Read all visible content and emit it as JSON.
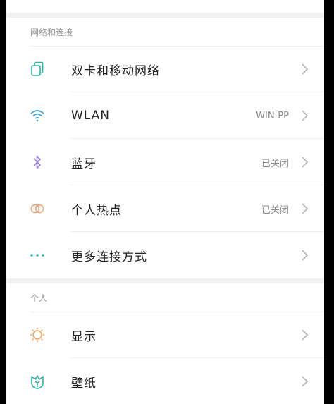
{
  "sections": [
    {
      "header": "网络和连接",
      "items": [
        {
          "label": "双卡和移动网络",
          "value": "",
          "icon": "dual-sim-icon"
        },
        {
          "label": "WLAN",
          "value": "WIN-PP",
          "icon": "wifi-icon"
        },
        {
          "label": "蓝牙",
          "value": "已关闭",
          "icon": "bluetooth-icon"
        },
        {
          "label": "个人热点",
          "value": "已关闭",
          "icon": "hotspot-icon"
        },
        {
          "label": "更多连接方式",
          "value": "",
          "icon": "more-dots-icon"
        }
      ]
    },
    {
      "header": "个人",
      "items": [
        {
          "label": "显示",
          "value": "",
          "icon": "display-sun-icon"
        },
        {
          "label": "壁纸",
          "value": "",
          "icon": "wallpaper-icon"
        }
      ]
    }
  ],
  "colors": {
    "sim_icon": "#2bb3a0",
    "wifi_icon": "#3aa0d8",
    "bluetooth_icon": "#9b82e0",
    "hotspot_icon": "#e8a070",
    "more_icon": "#2bb3a0",
    "display_icon": "#f0a050",
    "wallpaper_icon": "#2bb3a0"
  }
}
